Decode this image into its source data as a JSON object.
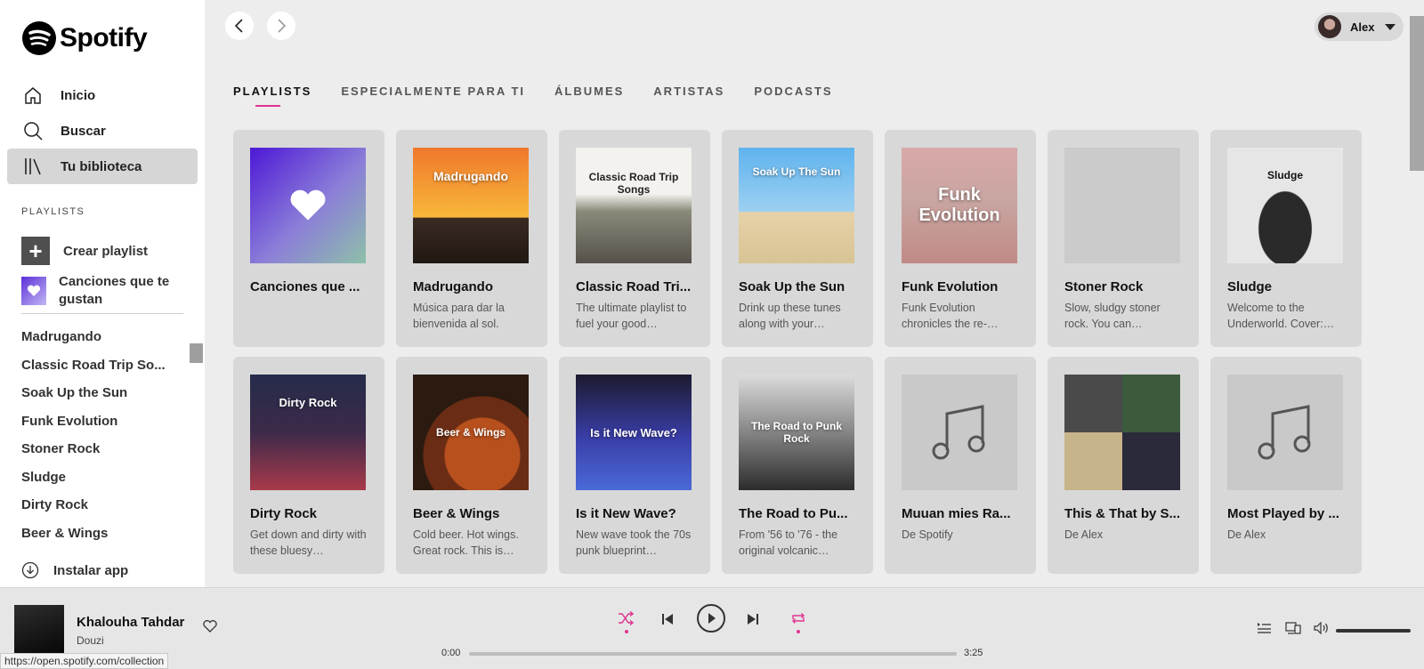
{
  "sidebar": {
    "logo_text": "Spotify",
    "nav": [
      {
        "label": "Inicio",
        "icon": "home-icon"
      },
      {
        "label": "Buscar",
        "icon": "search-icon"
      },
      {
        "label": "Tu biblioteca",
        "icon": "library-icon",
        "active": true
      }
    ],
    "playlists_header": "PLAYLISTS",
    "create_label": "Crear playlist",
    "liked_label": "Canciones que te gustan",
    "playlists": [
      "Madrugando",
      "Classic Road Trip So...",
      "Soak Up the Sun",
      "Funk Evolution",
      "Stoner Rock",
      "Sludge",
      "Dirty Rock",
      "Beer & Wings"
    ],
    "install_label": "Instalar app"
  },
  "header": {
    "user_name": "Alex"
  },
  "tabs": [
    {
      "label": "PLAYLISTS",
      "active": true
    },
    {
      "label": "ESPECIALMENTE PARA TI"
    },
    {
      "label": "ÁLBUMES"
    },
    {
      "label": "ARTISTAS"
    },
    {
      "label": "PODCASTS"
    }
  ],
  "cards": [
    {
      "title": "Canciones que ...",
      "desc": "",
      "art": "liked"
    },
    {
      "title": "Madrugando",
      "desc": "Música para dar la bienvenida al sol.",
      "art_text": "Madrugando",
      "art": "sunrise"
    },
    {
      "title": "Classic Road Tri...",
      "desc": "The ultimate playlist to fuel your good…",
      "art_text": "Classic Road Trip Songs",
      "art": "road"
    },
    {
      "title": "Soak Up the Sun",
      "desc": "Drink up these tunes along with your…",
      "art_text": "Soak Up The Sun",
      "art": "beach"
    },
    {
      "title": "Funk Evolution",
      "desc": "Funk Evolution chronicles the re-…",
      "art_text": "Funk Evolution",
      "art": "funk"
    },
    {
      "title": "Stoner Rock",
      "desc": "Slow, sludgy stoner rock. You can…",
      "art_text": "",
      "art": "blank"
    },
    {
      "title": "Sludge",
      "desc": "Welcome to the Underworld. Cover:…",
      "art_text": "Sludge",
      "art": "sludge"
    },
    {
      "title": "Dirty Rock",
      "desc": "Get down and dirty with these bluesy…",
      "art_text": "Dirty Rock",
      "art": "dirty"
    },
    {
      "title": "Beer & Wings",
      "desc": "Cold beer. Hot wings. Great rock. This is…",
      "art_text": "Beer & Wings",
      "art": "wings"
    },
    {
      "title": "Is it New Wave?",
      "desc": "New wave took the 70s punk blueprint…",
      "art_text": "Is it New Wave?",
      "art": "wave"
    },
    {
      "title": "The Road to Pu...",
      "desc": "From '56 to '76 - the original volcanic…",
      "art_text": "The Road to Punk Rock",
      "art": "punk"
    },
    {
      "title": "Muuan mies Ra...",
      "desc": "De Spotify",
      "art": "note"
    },
    {
      "title": "This & That by S...",
      "desc": "De Alex",
      "art": "collage"
    },
    {
      "title": "Most Played by ...",
      "desc": "De Alex",
      "art": "note"
    }
  ],
  "player": {
    "track": "Khalouha Tahdar",
    "artist": "Douzi",
    "elapsed": "0:00",
    "duration": "3:25",
    "progress": 0,
    "accent": "#e0338f"
  },
  "status_url": "https://open.spotify.com/collection"
}
